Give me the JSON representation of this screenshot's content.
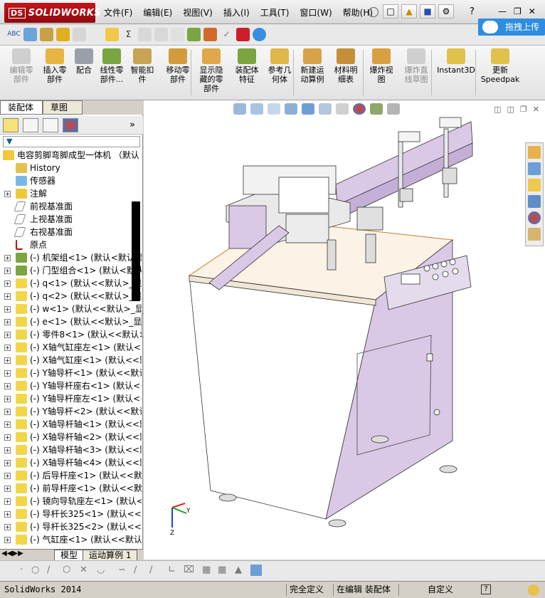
{
  "app": {
    "brand": "SOLIDWORKS",
    "brand_prefix": "DS"
  },
  "menu": {
    "items": [
      "文件(F)",
      "编辑(E)",
      "视图(V)",
      "插入(I)",
      "工具(T)",
      "窗口(W)",
      "帮助(H)"
    ]
  },
  "help_label": "?",
  "upload": {
    "label": "拖拽上传"
  },
  "command_manager": {
    "items": [
      {
        "label": "编辑零\n部件",
        "icon": "edit-component-icon",
        "disabled": true
      },
      {
        "label": "插入零\n部件",
        "icon": "insert-component-icon",
        "disabled": false
      },
      {
        "label": "配合",
        "icon": "mate-icon",
        "disabled": false
      },
      {
        "label": "线性零\n部件...",
        "icon": "linear-pattern-icon",
        "disabled": false
      },
      {
        "label": "智能扣\n件",
        "icon": "smart-fasteners-icon",
        "disabled": false
      },
      {
        "label": "移动零\n部件",
        "icon": "move-component-icon",
        "disabled": false
      },
      {
        "label": "显示隐\n藏的零\n部件",
        "icon": "show-hidden-icon",
        "disabled": false
      },
      {
        "label": "装配体\n特征",
        "icon": "assembly-feature-icon",
        "disabled": false
      },
      {
        "label": "参考几\n何体",
        "icon": "reference-geometry-icon",
        "disabled": false
      },
      {
        "label": "新建运\n动算例",
        "icon": "motion-study-icon",
        "disabled": false
      },
      {
        "label": "材料明\n细表",
        "icon": "bom-icon",
        "disabled": false
      },
      {
        "label": "爆炸视\n图",
        "icon": "exploded-view-icon",
        "disabled": false
      },
      {
        "label": "爆炸直\n线草图",
        "icon": "explode-line-icon",
        "disabled": true
      },
      {
        "label": "Instant3D",
        "icon": "instant3d-icon",
        "disabled": false
      },
      {
        "label": "更新\nSpeedpak",
        "icon": "speedpak-icon",
        "disabled": false
      }
    ]
  },
  "tabs": {
    "assembly": "装配体",
    "sketch": "草图"
  },
  "feature_tree": {
    "root": "电容剪脚弯脚成型一体机 （默认",
    "items": [
      {
        "label": "History",
        "icon": "history-icon",
        "expand": false
      },
      {
        "label": "传感器",
        "icon": "sensor-icon",
        "expand": false
      },
      {
        "label": "注解",
        "icon": "annotation-icon",
        "expand": true
      },
      {
        "label": "前视基准面",
        "icon": "plane-icon",
        "expand": false
      },
      {
        "label": "上视基准面",
        "icon": "plane-icon",
        "expand": false
      },
      {
        "label": "右视基准面",
        "icon": "plane-icon",
        "expand": false
      },
      {
        "label": "原点",
        "icon": "origin-icon",
        "expand": false
      },
      {
        "label": "(-) 机架组<1> (默认<默认_显",
        "icon": "subassembly-icon",
        "expand": true
      },
      {
        "label": "(-) 门型组合<1> (默认<默认",
        "icon": "subassembly-icon",
        "expand": true
      },
      {
        "label": "(-) q<1> (默认<<默认>_显示",
        "icon": "part-icon",
        "expand": true
      },
      {
        "label": "(-) q<2> (默认<<默认>_显示",
        "icon": "part-icon",
        "expand": true
      },
      {
        "label": "(-) w<1> (默认<<默认>_显示",
        "icon": "part-icon",
        "expand": true
      },
      {
        "label": "(-) e<1> (默认<<默认>_显示",
        "icon": "part-icon",
        "expand": true
      },
      {
        "label": "(-) 零件8<1> (默认<<默认>",
        "icon": "part-icon",
        "expand": true
      },
      {
        "label": "(-) X轴气缸座左<1> (默认<<",
        "icon": "part-icon",
        "expand": true
      },
      {
        "label": "(-) X轴气缸座<1> (默认<<默",
        "icon": "part-icon",
        "expand": true
      },
      {
        "label": "(-) Y轴导杆<1> (默认<<默认",
        "icon": "part-icon",
        "expand": true
      },
      {
        "label": "(-) Y轴导杆座右<1> (默认<<",
        "icon": "part-icon",
        "expand": true
      },
      {
        "label": "(-) Y轴导杆座左<1> (默认<<",
        "icon": "part-icon",
        "expand": true
      },
      {
        "label": "(-) Y轴导杆<2> (默认<<默认",
        "icon": "part-icon",
        "expand": true
      },
      {
        "label": "(-) X轴导杆轴<1> (默认<<默",
        "icon": "part-icon",
        "expand": true
      },
      {
        "label": "(-) X轴导杆轴<2> (默认<<默",
        "icon": "part-icon",
        "expand": true
      },
      {
        "label": "(-) X轴导杆轴<3> (默认<<默",
        "icon": "part-icon",
        "expand": true
      },
      {
        "label": "(-) X轴导杆轴<4> (默认<<默",
        "icon": "part-icon",
        "expand": true
      },
      {
        "label": "(-) 后导杆座<1> (默认<<默认",
        "icon": "part-icon",
        "expand": true
      },
      {
        "label": "(-) 前导杆座<1> (默认<<默认",
        "icon": "part-icon",
        "expand": true
      },
      {
        "label": "(-) 镜向导轨座左<1> (默认<",
        "icon": "part-icon",
        "expand": true
      },
      {
        "label": "(-) 导杆长325<1> (默认<<默",
        "icon": "part-icon",
        "expand": true
      },
      {
        "label": "(-) 导杆长325<2> (默认<<默",
        "icon": "part-icon",
        "expand": true
      },
      {
        "label": "(-) 气缸座<1> (默认<<默认",
        "icon": "part-icon",
        "expand": true
      }
    ]
  },
  "bottom_tabs": {
    "model": "模型",
    "motion": "运动算例 1"
  },
  "status": {
    "app_version": "SolidWorks 2014",
    "definition": "完全定义",
    "editing": "在编辑 装配体",
    "units": "自定义",
    "help": "?"
  },
  "colors": {
    "model_fill": "#ffffff",
    "model_accent": "#d9c9e6",
    "brand_red": "#c8141b",
    "upload_blue": "#2e8de0"
  }
}
